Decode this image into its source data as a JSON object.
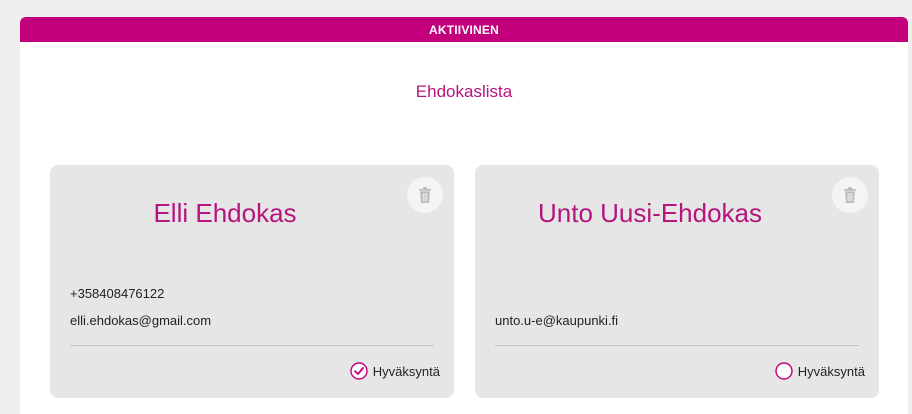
{
  "status": {
    "label": "AKTIIVINEN"
  },
  "list": {
    "title": "Ehdokaslista"
  },
  "candidates": [
    {
      "name": "Elli Ehdokas",
      "phone": "+358408476122",
      "email": "elli.ehdokas@gmail.com",
      "approval_label": "Hyväksyntä",
      "approved": true,
      "delete_icon": "trash-icon"
    },
    {
      "name": "Unto Uusi-Ehdokas",
      "phone": "",
      "email": "unto.u-e@kaupunki.fi",
      "approval_label": "Hyväksyntä",
      "approved": false,
      "delete_icon": "trash-icon"
    }
  ],
  "colors": {
    "accent": "#c2007b",
    "title_text": "#b5157d",
    "card_bg": "#e6e6e6",
    "page_bg": "#efefef"
  }
}
